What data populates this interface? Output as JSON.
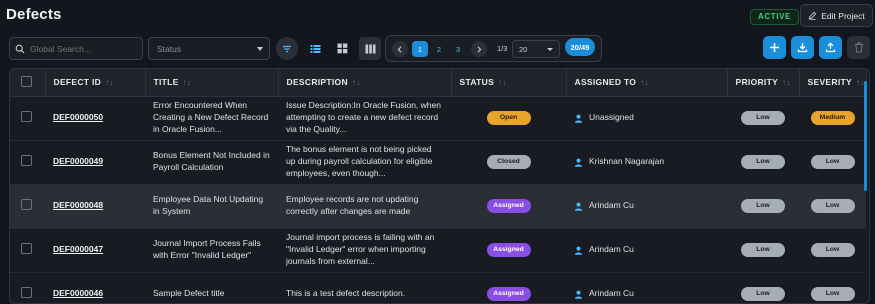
{
  "page": {
    "title": "Defects"
  },
  "header": {
    "status_badge": "ACTIVE",
    "edit_label": "Edit Project"
  },
  "toolbar": {
    "search_placeholder": "Global Search...",
    "status_placeholder": "Status",
    "pagination": {
      "pages": [
        "1",
        "2",
        "3"
      ],
      "current_page": "1",
      "page_info": "1/3",
      "page_size": "20"
    },
    "count_badge": "20/49"
  },
  "table": {
    "columns": [
      "DEFECT ID",
      "TITLE",
      "DESCRIPTION",
      "STATUS",
      "ASSIGNED TO",
      "PRIORITY",
      "SEVERITY"
    ],
    "rows": [
      {
        "id": "DEF0000050",
        "title": "Error Encountered When Creating a New Defect Record in Oracle Fusion...",
        "description": "Issue Description:In Oracle Fusion, when attempting to create a new defect record via the Quality...",
        "status": "Open",
        "assigned": "Unassigned",
        "priority": "Low",
        "severity": "Medium"
      },
      {
        "id": "DEF0000049",
        "title": "Bonus Element Not Included in Payroll Calculation",
        "description": "The bonus element is not being picked up during payroll calculation for eligible employees, even though...",
        "status": "Closed",
        "assigned": "Krishnan Nagarajan",
        "priority": "Low",
        "severity": "Low"
      },
      {
        "id": "DEF0000048",
        "title": "Employee Data Not Updating in System",
        "description": "Employee records are not updating correctly after changes are made",
        "status": "Assigned",
        "assigned": "Arindam Cu",
        "priority": "Low",
        "severity": "Low"
      },
      {
        "id": "DEF0000047",
        "title": "Journal Import Process Fails with Error \"Invalid Ledger\"",
        "description": "Journal import process is failing with an \"Invalid Ledger\" error when importing journals from external...",
        "status": "Assigned",
        "assigned": "Arindam Cu",
        "priority": "Low",
        "severity": "Low"
      },
      {
        "id": "DEF0000046",
        "title": "Sample Defect title",
        "description": "This is a test defect description.",
        "status": "Assigned",
        "assigned": "Arindam Cu",
        "priority": "Low",
        "severity": "Low"
      }
    ]
  },
  "colors": {
    "accent": "#1a8ed8",
    "open": "#e8a42a",
    "closed": "#a6adb7",
    "assigned": "#8a4ee6",
    "active_green": "#3fd07a"
  },
  "icons": [
    "search-icon",
    "chevron-down-icon",
    "filter-icon",
    "list-view-icon",
    "grid-view-icon",
    "columns-icon",
    "chevron-left-icon",
    "chevron-right-icon",
    "plus-icon",
    "download-icon",
    "upload-icon",
    "trash-icon",
    "user-icon",
    "edit-icon",
    "sort-icon"
  ]
}
